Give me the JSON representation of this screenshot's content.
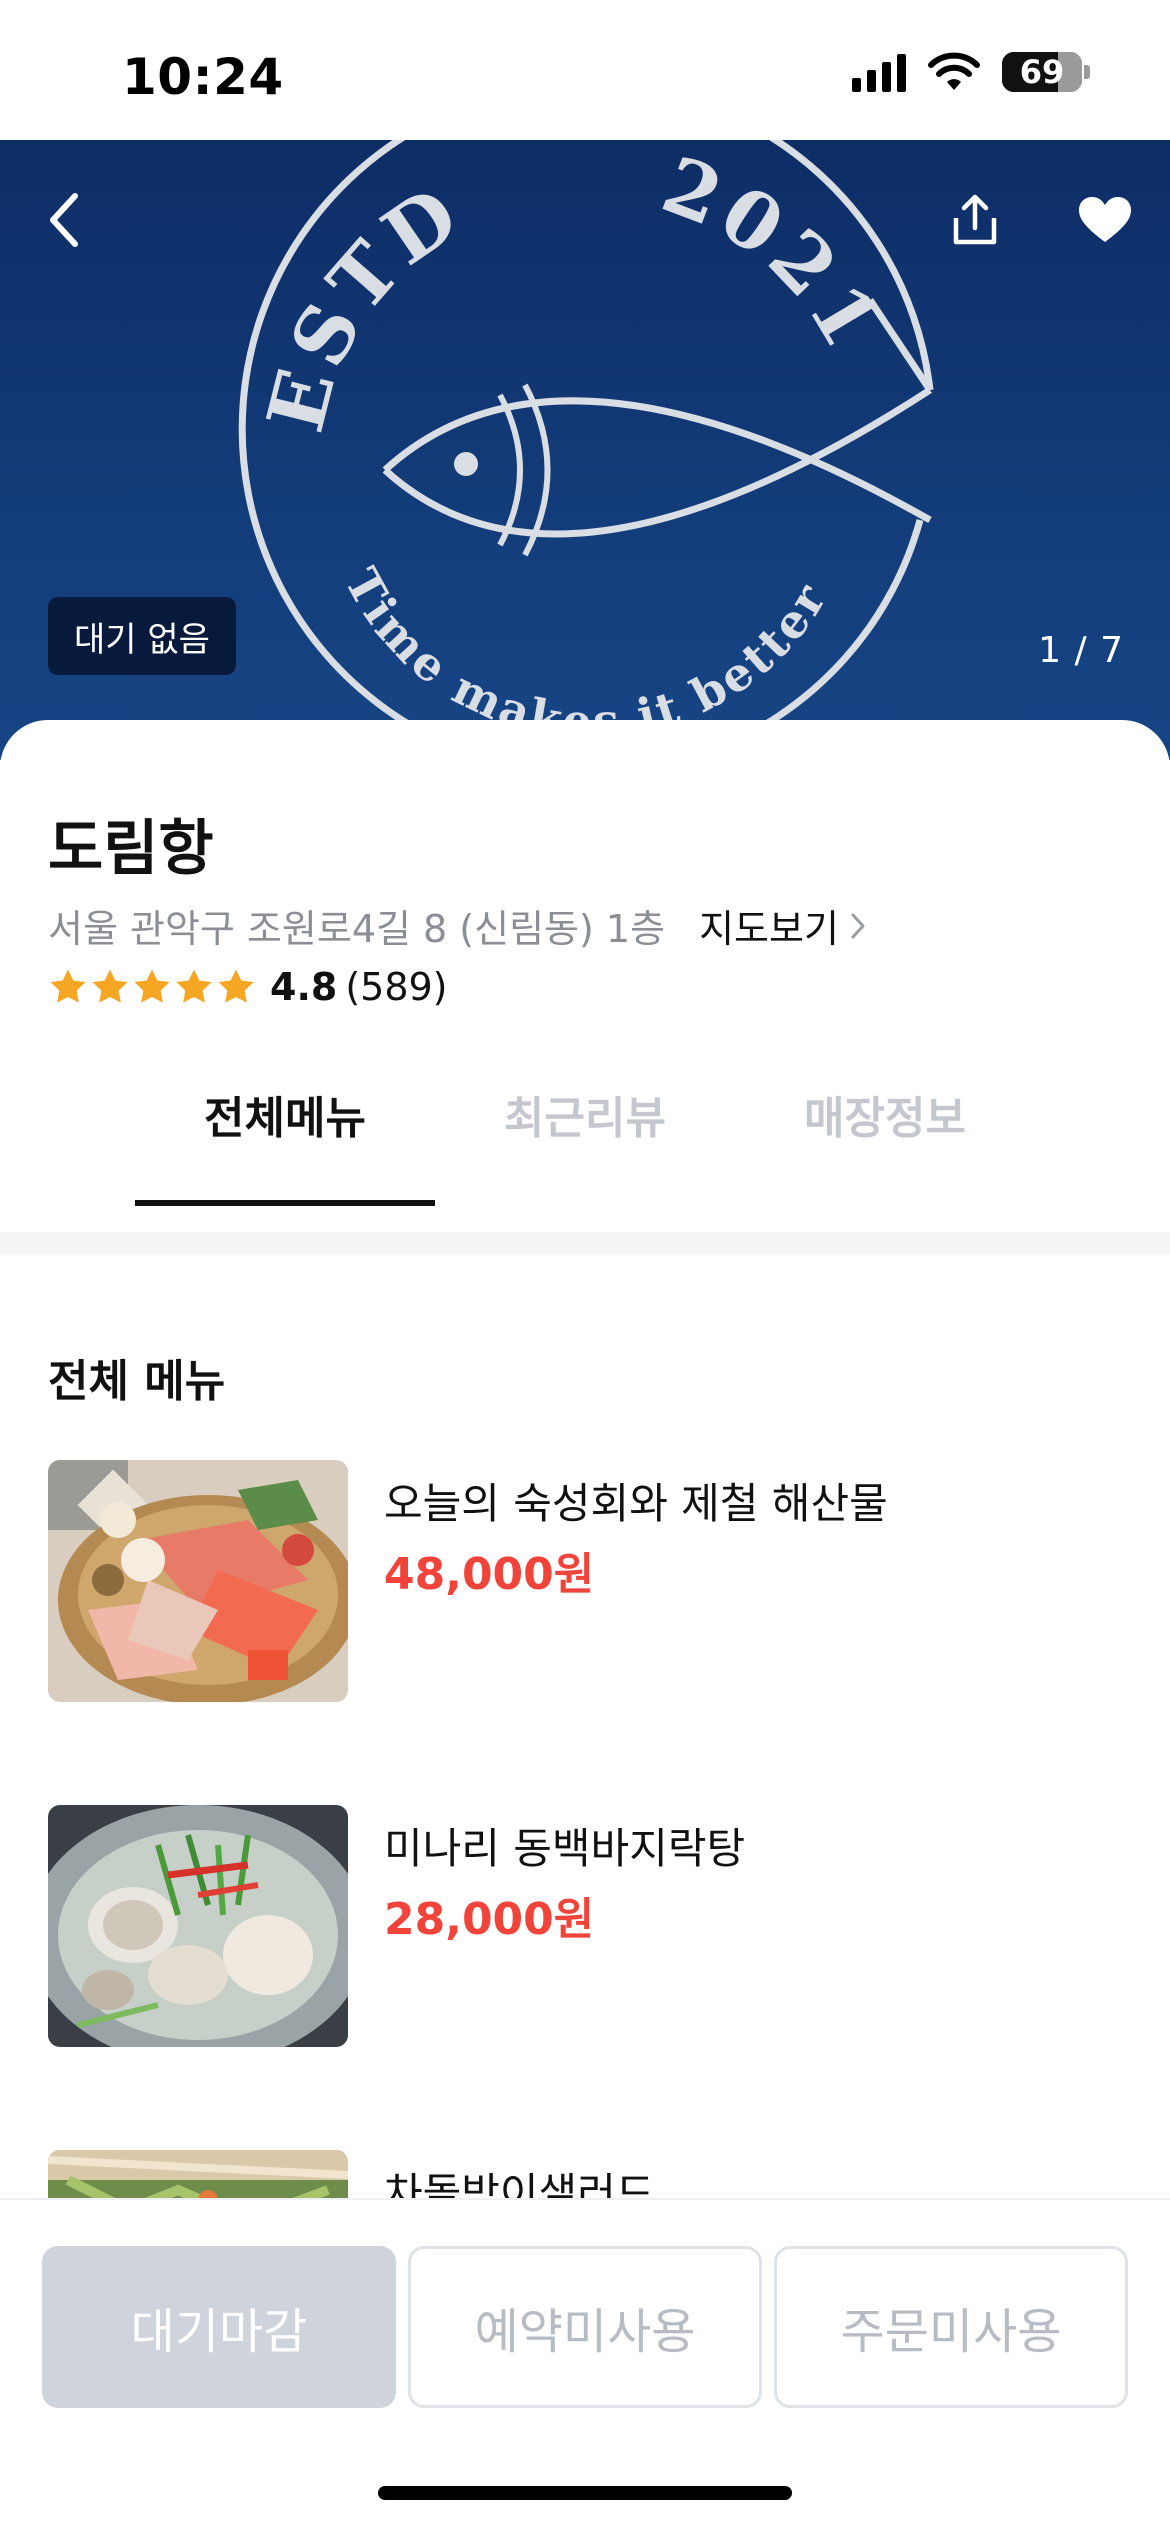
{
  "status_bar": {
    "time": "10:24",
    "battery": "69"
  },
  "hero": {
    "logo_text": {
      "top_left": "ESTD",
      "top_right": "2021",
      "bottom": "Time makes it better"
    },
    "wait_badge": "대기 없음",
    "page_counter": "1 / 7",
    "colors": {
      "background": "#123b78",
      "logo_line": "#d9dde4"
    }
  },
  "store": {
    "name": "도림항",
    "address": "서울 관악구 조원로4길 8 (신림동) 1층",
    "map_link": "지도보기",
    "rating": "4.8",
    "review_count": "(589)",
    "star_count": 5
  },
  "tabs": [
    {
      "label": "전체메뉴",
      "active": true
    },
    {
      "label": "최근리뷰",
      "active": false
    },
    {
      "label": "매장정보",
      "active": false
    }
  ],
  "menu_section": {
    "title": "전체 메뉴",
    "items": [
      {
        "name": "오늘의 숙성회와 제철 해산물",
        "price": "48,000원"
      },
      {
        "name": "미나리 동백바지락탕",
        "price": "28,000원"
      },
      {
        "name": "차돌박이샐러드",
        "price": ""
      }
    ]
  },
  "bottom_bar": {
    "wait_button": "대기마감",
    "reserve_button": "예약미사용",
    "order_button": "주문미사용"
  },
  "colors": {
    "price": "#f0443b",
    "star": "#f5a623",
    "disabled_button": "#cfd3db"
  }
}
